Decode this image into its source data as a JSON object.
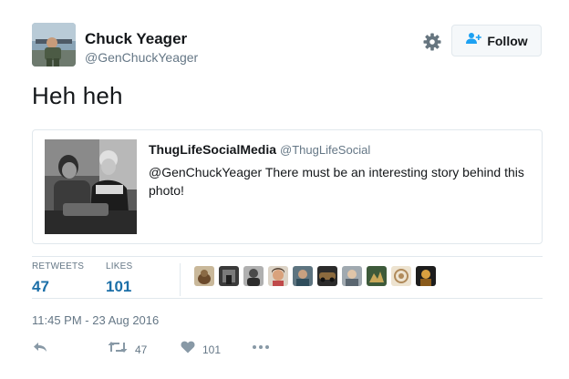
{
  "author": {
    "name": "Chuck Yeager",
    "handle": "@GenChuckYeager"
  },
  "follow_button": {
    "label": "Follow"
  },
  "tweet": {
    "text": "Heh heh"
  },
  "quoted_tweet": {
    "name": "ThugLifeSocialMedia",
    "handle": "@ThugLifeSocial",
    "text": "@GenChuckYeager There must be an interesting story behind this photo!"
  },
  "stats": {
    "retweets_label": "RETWEETS",
    "retweets_value": "47",
    "likes_label": "LIKES",
    "likes_value": "101"
  },
  "timestamp": "11:45 PM - 23 Aug 2016",
  "actions": {
    "retweet_count": "47",
    "like_count": "101"
  },
  "colors": {
    "text": "#14171a",
    "secondary": "#657786",
    "stat_value": "#1b6fa8",
    "border": "#e1e8ed",
    "icon": "#8899a6"
  },
  "icons": [
    "gear-icon",
    "follow-person-icon",
    "reply-icon",
    "retweet-icon",
    "heart-icon",
    "more-icon"
  ]
}
